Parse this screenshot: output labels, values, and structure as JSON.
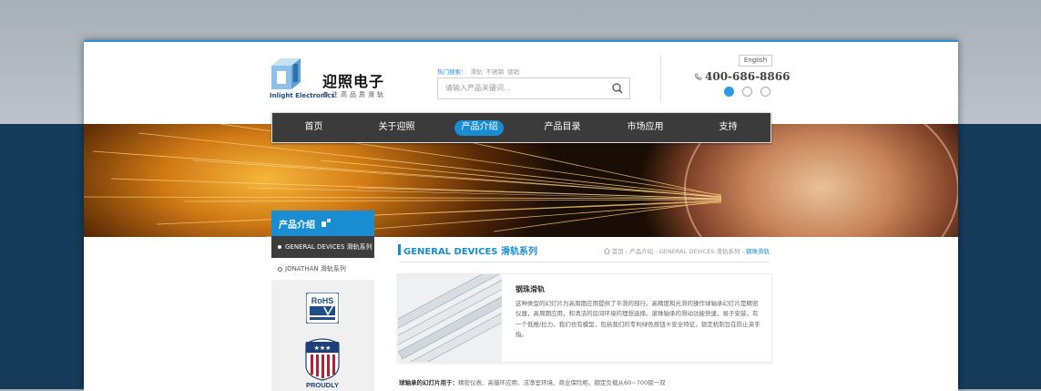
{
  "header": {
    "logo_cn": "迎照电子",
    "logo_en": "Inlight Electronics",
    "logo_slogan": "专注高品质滑轨",
    "hot_label": "热门搜索：",
    "hot_keywords": [
      "滑轨",
      "不锈钢",
      "锁销"
    ],
    "search_placeholder": "请输入产品关键词...",
    "language": "English",
    "phone": "400-686-8866"
  },
  "nav": {
    "items": [
      "首页",
      "关于迎照",
      "产品介绍",
      "产品目录",
      "市场应用",
      "支持"
    ],
    "active": "产品介绍"
  },
  "sidebar": {
    "title": "产品介绍",
    "items": [
      "GENERAL DEVICES 滑轨系列",
      "JONATHAN 滑轨系列"
    ],
    "active": "GENERAL DEVICES 滑轨系列",
    "badges": [
      "RoHS",
      "PROUDLY"
    ]
  },
  "main": {
    "title": "GENERAL DEVICES 滑轨系列",
    "breadcrumb": [
      "首页",
      "产品介绍",
      "GENERAL DEVICES 滑轨系列",
      "钢珠滑轨"
    ],
    "product": {
      "name": "钢珠滑轨",
      "description": "这种类型的幻灯片为高周期应用提供了平滑的部行。高精度和光滑的操作球轴承幻灯片是精密仪器，高周期应用，和清洁的房间环境的理想选择。滚珠轴承的滑动功能快速，易于安装，有一个低推/拉力。我们也有模型，包括我们的专利绿色按钮®安全特征，锁定机制旨在防止夹手指。"
    },
    "applications_label": "球轴承的幻灯片用于：",
    "applications_text": "精密仪表、高循环应用、洁净室环境、商业保险柜。额定负载从60~700磅一双"
  },
  "colors": {
    "accent": "#1a8cd1",
    "nav_bg": "#3b3b3b",
    "page_bg": "#163b58"
  }
}
